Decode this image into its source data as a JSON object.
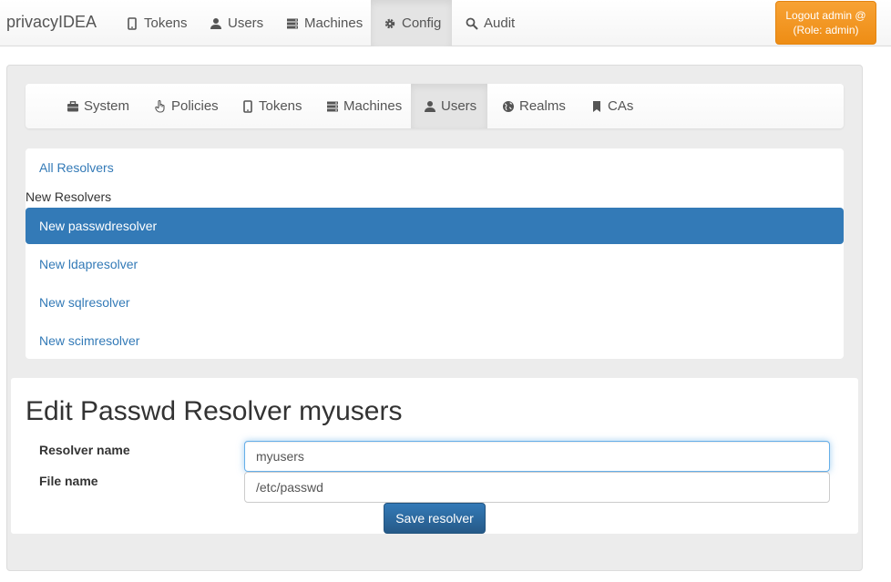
{
  "app": {
    "brand": "privacyIDEA"
  },
  "topnav": {
    "tokens": "Tokens",
    "users": "Users",
    "machines": "Machines",
    "config": "Config",
    "audit": "Audit",
    "logout_line1": "Logout admin @",
    "logout_line2": "(Role: admin)"
  },
  "config_nav": {
    "system": "System",
    "policies": "Policies",
    "tokens": "Tokens",
    "machines": "Machines",
    "users": "Users",
    "realms": "Realms",
    "cas": "CAs"
  },
  "resolvers": {
    "all": "All Resolvers",
    "new_header": "New Resolvers",
    "items": [
      "New passwdresolver",
      "New ldapresolver",
      "New sqlresolver",
      "New scimresolver"
    ]
  },
  "edit": {
    "title": "Edit Passwd Resolver myusers",
    "resolver_name_label": "Resolver name",
    "resolver_name_value": "myusers",
    "file_name_label": "File name",
    "file_name_value": "/etc/passwd",
    "save_label": "Save resolver"
  },
  "colors": {
    "primary": "#337ab7",
    "warning": "#f0ad4e"
  }
}
